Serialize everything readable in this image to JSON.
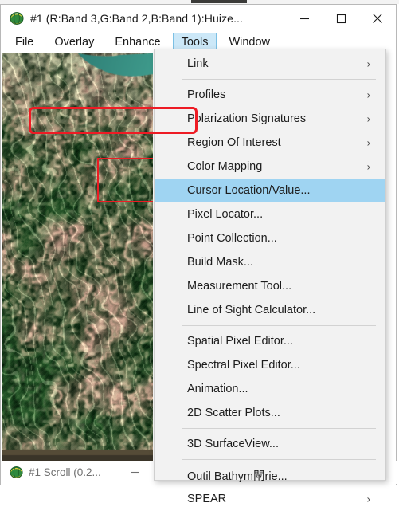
{
  "window": {
    "title": "#1 (R:Band 3,G:Band 2,B:Band 1):Huize...",
    "icon": "envi-globe-icon",
    "controls": {
      "minimize": "minimize-button",
      "maximize": "maximize-button",
      "close": "close-button"
    }
  },
  "menubar": {
    "items": [
      {
        "label": "File",
        "active": false
      },
      {
        "label": "Overlay",
        "active": false
      },
      {
        "label": "Enhance",
        "active": false
      },
      {
        "label": "Tools",
        "active": true
      },
      {
        "label": "Window",
        "active": false
      }
    ]
  },
  "tools_menu": {
    "items": [
      {
        "label": "Link",
        "submenu": true,
        "selected": false,
        "separator_after": true
      },
      {
        "label": "Profiles",
        "submenu": true,
        "selected": false,
        "separator_after": false
      },
      {
        "label": "Polarization Signatures",
        "submenu": true,
        "selected": false,
        "separator_after": false
      },
      {
        "label": "Region Of Interest",
        "submenu": true,
        "selected": false,
        "separator_after": false
      },
      {
        "label": "Color Mapping",
        "submenu": true,
        "selected": false,
        "separator_after": false
      },
      {
        "label": "Cursor Location/Value...",
        "submenu": false,
        "selected": true,
        "separator_after": false
      },
      {
        "label": "Pixel Locator...",
        "submenu": false,
        "selected": false,
        "separator_after": false
      },
      {
        "label": "Point Collection...",
        "submenu": false,
        "selected": false,
        "separator_after": false
      },
      {
        "label": "Build Mask...",
        "submenu": false,
        "selected": false,
        "separator_after": false
      },
      {
        "label": "Measurement Tool...",
        "submenu": false,
        "selected": false,
        "separator_after": false
      },
      {
        "label": "Line of Sight Calculator...",
        "submenu": false,
        "selected": false,
        "separator_after": true
      },
      {
        "label": "Spatial Pixel Editor...",
        "submenu": false,
        "selected": false,
        "separator_after": false
      },
      {
        "label": "Spectral Pixel Editor...",
        "submenu": false,
        "selected": false,
        "separator_after": false
      },
      {
        "label": "Animation...",
        "submenu": false,
        "selected": false,
        "separator_after": false
      },
      {
        "label": "2D Scatter Plots...",
        "submenu": false,
        "selected": false,
        "separator_after": true
      },
      {
        "label": "3D SurfaceView...",
        "submenu": false,
        "selected": false,
        "separator_after": true
      },
      {
        "label": "Outil Bathym閛rie...",
        "submenu": false,
        "selected": false,
        "separator_after": false
      },
      {
        "label": "SPEAR",
        "submenu": true,
        "selected": false,
        "separator_after": false
      }
    ],
    "submenu_glyph": "›",
    "annotation_color": "#ee1b24",
    "selection_color": "#9fd4f2"
  },
  "scroll_window": {
    "icon": "envi-globe-icon",
    "title": "#1 Scroll (0.2...",
    "minimize": "minimize-button"
  },
  "image_view": {
    "description": "satellite-image-mountainous-terrain",
    "roi_annotation_color": "#ec1c24"
  },
  "colors": {
    "menu_background": "#f2f2f2",
    "menu_highlight": "#cce8f8",
    "menu_highlight_border": "#7cc0e4",
    "selection": "#9fd4f2",
    "annotation_red": "#ee1b24",
    "text": "#1d1d1d",
    "muted_text": "#6f6f6f"
  }
}
